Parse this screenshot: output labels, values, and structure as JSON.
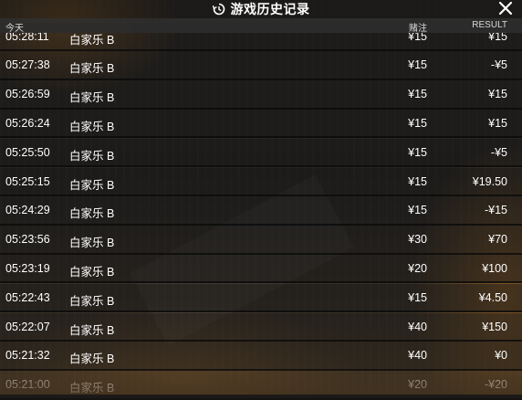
{
  "window": {
    "title": "游戏历史记录",
    "icons": {
      "title": "history-icon",
      "close": "close-icon"
    }
  },
  "table": {
    "headers": {
      "date": "今天",
      "bet": "赌注",
      "result": "RESULT"
    },
    "rows": [
      {
        "time": "05:28:11",
        "game": "白家乐 B",
        "bet": "¥15",
        "result": "¥15"
      },
      {
        "time": "05:27:38",
        "game": "白家乐 B",
        "bet": "¥15",
        "result": "-¥5"
      },
      {
        "time": "05:26:59",
        "game": "白家乐 B",
        "bet": "¥15",
        "result": "¥15"
      },
      {
        "time": "05:26:24",
        "game": "白家乐 B",
        "bet": "¥15",
        "result": "¥15"
      },
      {
        "time": "05:25:50",
        "game": "白家乐 B",
        "bet": "¥15",
        "result": "-¥5"
      },
      {
        "time": "05:25:15",
        "game": "白家乐 B",
        "bet": "¥15",
        "result": "¥19.50"
      },
      {
        "time": "05:24:29",
        "game": "白家乐 B",
        "bet": "¥15",
        "result": "-¥15"
      },
      {
        "time": "05:23:56",
        "game": "白家乐 B",
        "bet": "¥30",
        "result": "¥70"
      },
      {
        "time": "05:23:19",
        "game": "白家乐 B",
        "bet": "¥20",
        "result": "¥100"
      },
      {
        "time": "05:22:43",
        "game": "白家乐 B",
        "bet": "¥15",
        "result": "¥4.50"
      },
      {
        "time": "05:22:07",
        "game": "白家乐 B",
        "bet": "¥40",
        "result": "¥150"
      },
      {
        "time": "05:21:32",
        "game": "白家乐 B",
        "bet": "¥40",
        "result": "¥0"
      },
      {
        "time": "05:21:00",
        "game": "白家乐 B",
        "bet": "¥20",
        "result": "-¥20"
      }
    ]
  }
}
